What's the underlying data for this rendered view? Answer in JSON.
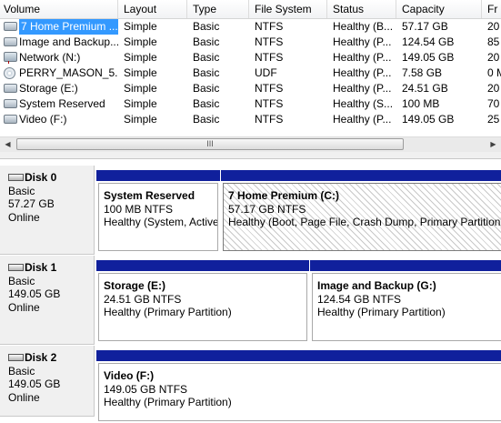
{
  "columns": [
    "Volume",
    "Layout",
    "Type",
    "File System",
    "Status",
    "Capacity",
    "Fr"
  ],
  "volumes": [
    {
      "name": "7 Home Premium ...",
      "icon": "drive-icon",
      "layout": "Simple",
      "type": "Basic",
      "fs": "NTFS",
      "status": "Healthy (B...",
      "capacity": "57.17 GB",
      "free": "20"
    },
    {
      "name": "Image and Backup...",
      "icon": "drive-icon",
      "layout": "Simple",
      "type": "Basic",
      "fs": "NTFS",
      "status": "Healthy (P...",
      "capacity": "124.54 GB",
      "free": "85"
    },
    {
      "name": "Network (N:)",
      "icon": "network-drive-icon",
      "layout": "Simple",
      "type": "Basic",
      "fs": "NTFS",
      "status": "Healthy (P...",
      "capacity": "149.05 GB",
      "free": "20"
    },
    {
      "name": "PERRY_MASON_5...",
      "icon": "cd-icon",
      "layout": "Simple",
      "type": "Basic",
      "fs": "UDF",
      "status": "Healthy (P...",
      "capacity": "7.58 GB",
      "free": "0 M"
    },
    {
      "name": "Storage (E:)",
      "icon": "drive-icon",
      "layout": "Simple",
      "type": "Basic",
      "fs": "NTFS",
      "status": "Healthy (P...",
      "capacity": "24.51 GB",
      "free": "20"
    },
    {
      "name": "System Reserved",
      "icon": "drive-icon",
      "layout": "Simple",
      "type": "Basic",
      "fs": "NTFS",
      "status": "Healthy (S...",
      "capacity": "100 MB",
      "free": "70"
    },
    {
      "name": "Video (F:)",
      "icon": "drive-icon",
      "layout": "Simple",
      "type": "Basic",
      "fs": "NTFS",
      "status": "Healthy (P...",
      "capacity": "149.05 GB",
      "free": "25"
    }
  ],
  "scrollbar": {
    "thumb_grip": "III",
    "left_arrow": "◀",
    "right_arrow": "▶"
  },
  "disks": [
    {
      "title": "Disk 0",
      "type": "Basic",
      "size": "57.27 GB",
      "state": "Online",
      "partitions": [
        {
          "name": "System Reserved",
          "size": "100 MB NTFS",
          "status": "Healthy (System, Active, Primary Partition)"
        },
        {
          "name": "7 Home Premium  (C:)",
          "size": "57.17 GB NTFS",
          "status": "Healthy (Boot, Page File, Crash Dump, Primary Partition)"
        }
      ]
    },
    {
      "title": "Disk 1",
      "type": "Basic",
      "size": "149.05 GB",
      "state": "Online",
      "partitions": [
        {
          "name": "Storage  (E:)",
          "size": "24.51 GB NTFS",
          "status": "Healthy (Primary Partition)"
        },
        {
          "name": "Image and Backup  (G:)",
          "size": "124.54 GB NTFS",
          "status": "Healthy (Primary Partition)"
        }
      ]
    },
    {
      "title": "Disk 2",
      "type": "Basic",
      "size": "149.05 GB",
      "state": "Online",
      "partitions": [
        {
          "name": "Video  (F:)",
          "size": "149.05 GB NTFS",
          "status": "Healthy (Primary Partition)"
        }
      ]
    }
  ],
  "colors": {
    "partition_bar": "#10209c",
    "selection": "#3399ff"
  }
}
